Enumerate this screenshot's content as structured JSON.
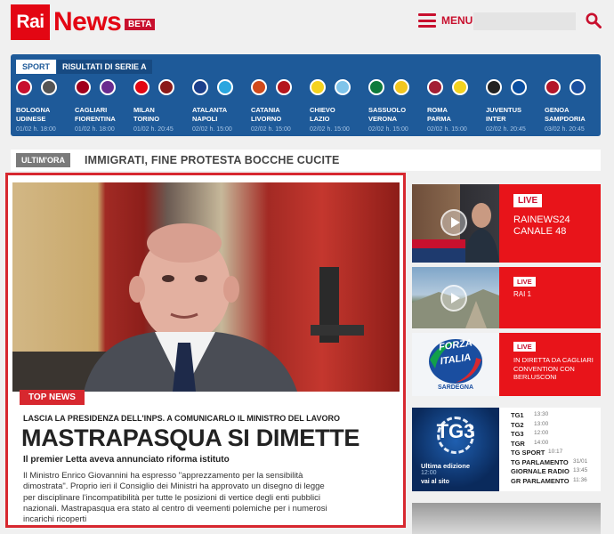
{
  "header": {
    "logo_box": "Rai",
    "logo_word": "News",
    "beta": "BETA",
    "menu_label": "MENU",
    "search_value": ""
  },
  "scores": {
    "sport_tag": "SPORT",
    "title": "RISULTATI DI SERIE A",
    "matches": [
      {
        "home": "BOLOGNA",
        "away": "UDINESE",
        "date": "01/02",
        "time": "h. 18:00",
        "c1": "#c8102e",
        "c2": "#555555"
      },
      {
        "home": "CAGLIARI",
        "away": "FIORENTINA",
        "date": "01/02",
        "time": "h. 18:00",
        "c1": "#a1001d",
        "c2": "#6a2c8f"
      },
      {
        "home": "MILAN",
        "away": "TORINO",
        "date": "01/02",
        "time": "h. 20:45",
        "c1": "#e30613",
        "c2": "#8b1a1a"
      },
      {
        "home": "ATALANTA",
        "away": "NAPOLI",
        "date": "02/02",
        "time": "h. 15:00",
        "c1": "#1b3f8b",
        "c2": "#2aa6df"
      },
      {
        "home": "CATANIA",
        "away": "LIVORNO",
        "date": "02/02",
        "time": "h. 15:00",
        "c1": "#d04a1b",
        "c2": "#b5161d"
      },
      {
        "home": "CHIEVO",
        "away": "LAZIO",
        "date": "02/02",
        "time": "h. 15:00",
        "c1": "#f4d21f",
        "c2": "#7fc4ea"
      },
      {
        "home": "SASSUOLO",
        "away": "VERONA",
        "date": "02/02",
        "time": "h. 15:00",
        "c1": "#0e7a3c",
        "c2": "#f2c61f"
      },
      {
        "home": "ROMA",
        "away": "PARMA",
        "date": "02/02",
        "time": "h. 15:00",
        "c1": "#a31f34",
        "c2": "#f2d21f"
      },
      {
        "home": "JUVENTUS",
        "away": "INTER",
        "date": "02/02",
        "time": "h. 20:45",
        "c1": "#222222",
        "c2": "#0a4ea0"
      },
      {
        "home": "GENOA",
        "away": "SAMPDORIA",
        "date": "03/02",
        "time": "h. 20:45",
        "c1": "#b3162a",
        "c2": "#1b4fa0"
      }
    ]
  },
  "breaking": {
    "tag": "ULTIM'ORA",
    "text": "IMMIGRATI, FINE PROTESTA BOCCHE CUCITE"
  },
  "top_story": {
    "tag": "TOP NEWS",
    "kicker": "LASCIA LA PRESIDENZA DELL'INPS. A COMUNICARLO IL MINISTRO DEL LAVORO",
    "headline": "MASTRAPASQUA SI DIMETTE",
    "subhead": "Il premier Letta aveva annunciato riforma istituto",
    "body": "Il Ministro Enrico Giovannini ha espresso \"apprezzamento per la sensibilità dimostrata\". Proprio ieri il Consiglio dei Ministri ha approvato un disegno di legge per disciplinare l'incompatibilità per tutte le posizioni di vertice degli enti pubblici nazionali. Mastrapasqua era stato al centro di veementi polemiche per i numerosi incarichi ricoperti"
  },
  "live": [
    {
      "badge": "LIVE",
      "title": "RAINEWS24\nCANALE 48"
    },
    {
      "badge": "LIVE",
      "title": "RAI 1"
    },
    {
      "badge": "LIVE",
      "title": "IN DIRETTA DA CAGLIARI CONVENTION CON BERLUSCONI",
      "thumb_line1": "FORZA",
      "thumb_line2": "ITALIA",
      "thumb_line3": "SARDEGNA"
    }
  ],
  "tg": {
    "logo_num": "TG3",
    "edition": "Ultima edizione",
    "edition_time": "12:00",
    "site": "vai al sito",
    "items": [
      {
        "name": "TG1",
        "time": "13:30"
      },
      {
        "name": "TG2",
        "time": "13:00"
      },
      {
        "name": "TG3",
        "time": "12:00"
      },
      {
        "name": "TGR",
        "time": "14:00"
      },
      {
        "name": "TG SPORT",
        "time": "10:17"
      },
      {
        "name": "TG PARLAMENTO",
        "time": "31/01"
      },
      {
        "name": "GIORNALE RADIO",
        "time": "13:45"
      },
      {
        "name": "GR PARLAMENTO",
        "time": "11:36"
      }
    ]
  },
  "colors": {
    "brand_red": "#e30613",
    "score_bar_blue": "#1e5a99",
    "live_red": "#e8141a"
  }
}
